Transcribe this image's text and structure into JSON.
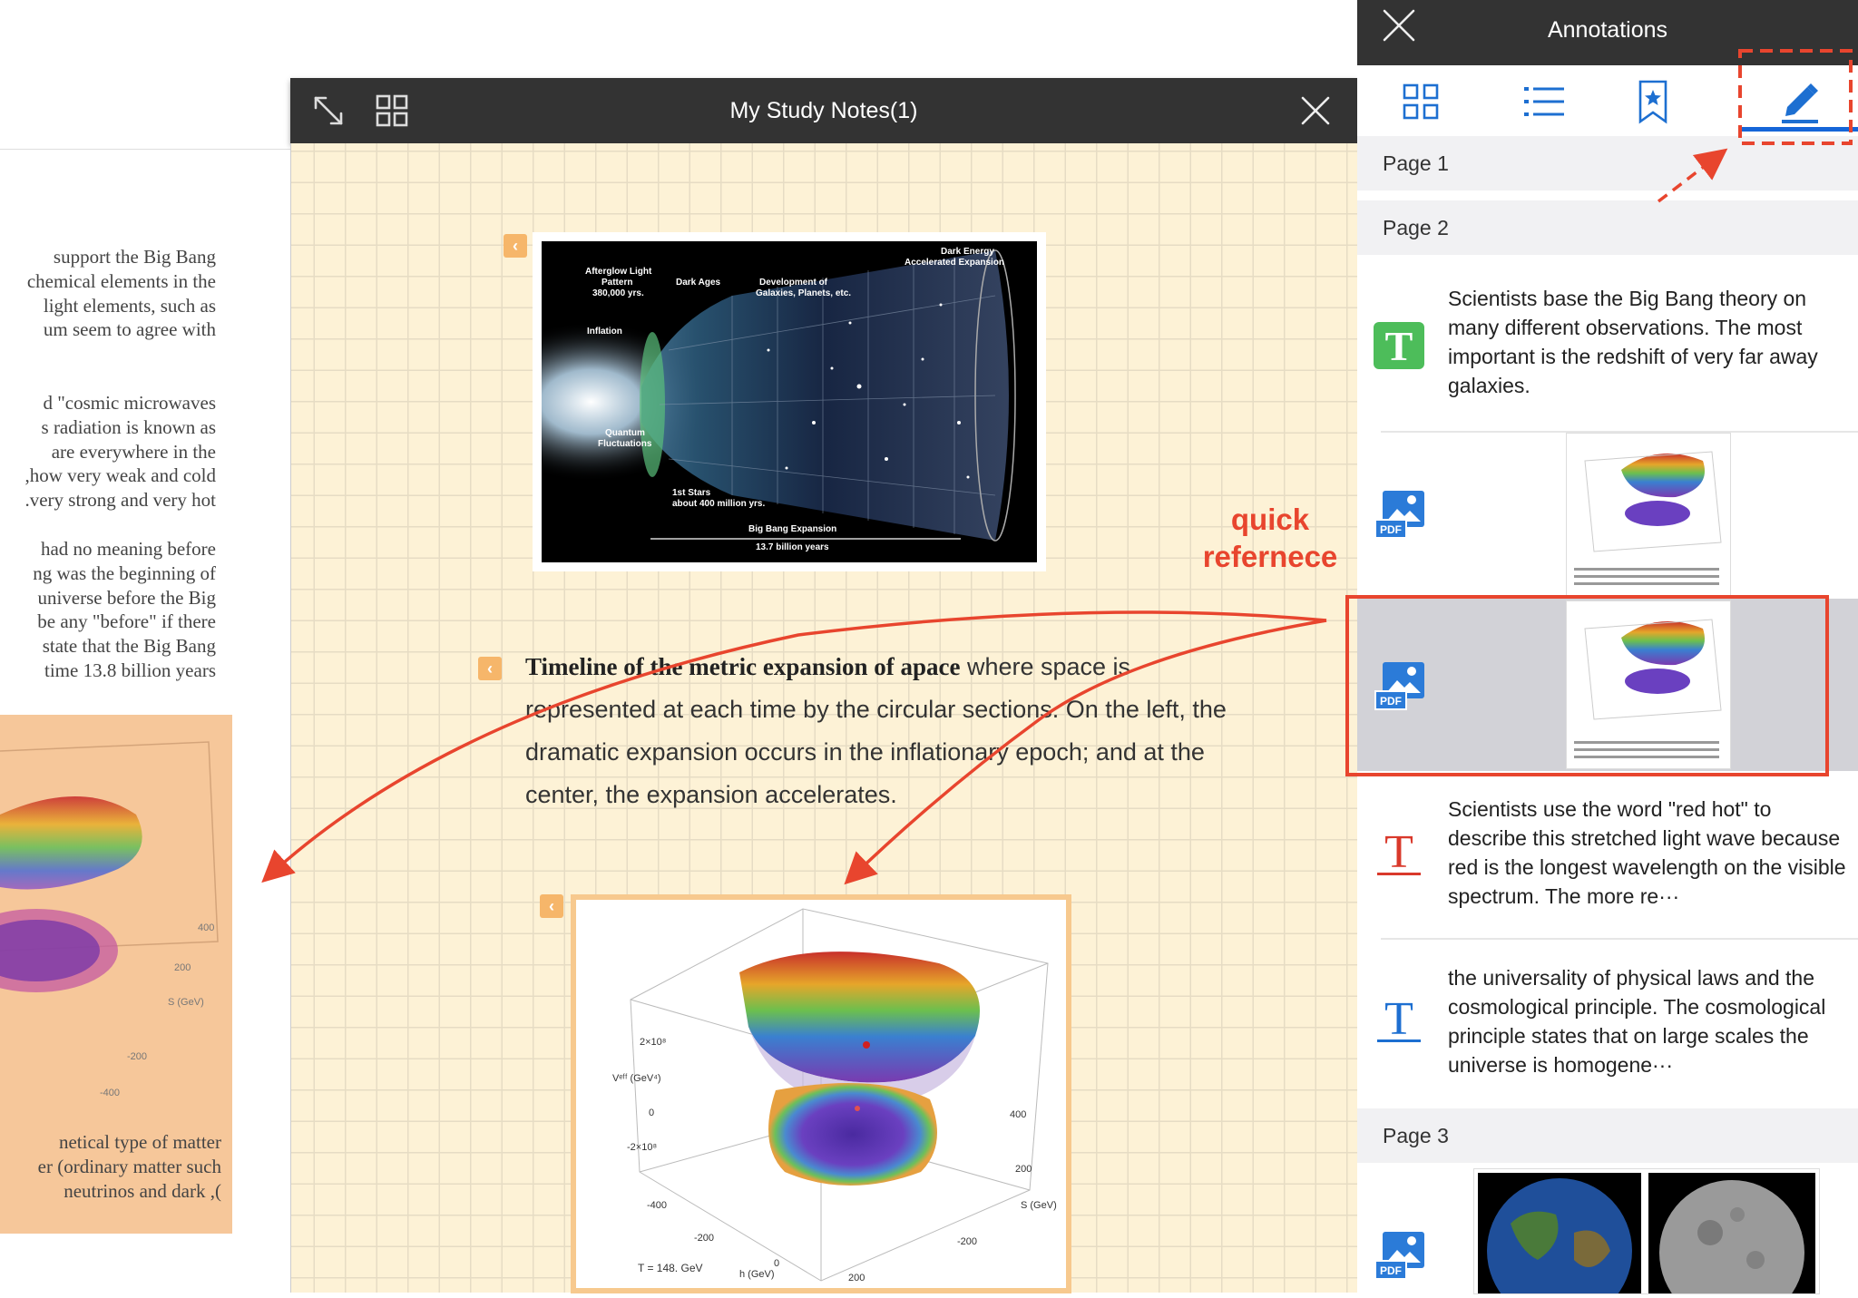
{
  "document": {
    "paragraphs": [
      [
        "support the Big Bang",
        "chemical elements in the",
        "light elements, such as",
        "um seem to agree with"
      ],
      [
        "d \"cosmic microwaves",
        "s radiation is known as",
        "are everywhere in the",
        "how very weak and cold,",
        "very strong and very hot."
      ],
      [
        "had no meaning before",
        "ng was the beginning of",
        "universe before the Big",
        "be any \"before\" if there",
        "state that the Big Bang",
        "time 13.8 billion years"
      ],
      [
        "netical type of matter",
        "er (ordinary matter such",
        "), neutrinos and dark"
      ]
    ]
  },
  "notes_window": {
    "title": "My Study Notes(1)",
    "note": {
      "bold": "Timeline of the metric expansion of apace",
      "text": " where space is represented at each time by the circular sections. On the left, the dramatic expansion occurs in the inflationary epoch; and at the center, the expansion accelerates."
    },
    "universe_image": {
      "labels": {
        "dark_energy": "Dark Energy",
        "accel": "Accelerated Expansion",
        "afterglow": "Afterglow Light",
        "pattern": "Pattern",
        "years380": "380,000 yrs.",
        "dark_ages": "Dark Ages",
        "dev": "Development of",
        "galaxies": "Galaxies, Planets, etc.",
        "inflation": "Inflation",
        "quantum": "Quantum",
        "fluct": "Fluctuations",
        "first_stars": "1st Stars",
        "about400": "about 400 million yrs.",
        "bbe": "Big Bang Expansion",
        "age": "13.7 billion years"
      }
    },
    "plot_image": {
      "t_label": "T = 148.  GeV",
      "axis_v": "Vᵉᶠᶠ (GeV⁴)",
      "axis_h": "h (GeV)",
      "axis_s": "S (GeV)"
    }
  },
  "panel": {
    "title": "Annotations",
    "tabs": [
      "thumbnails",
      "outline",
      "bookmarks",
      "annotations"
    ],
    "sections": {
      "page1": "Page 1",
      "page2": "Page 2",
      "page3": "Page 3"
    },
    "items": [
      {
        "type": "text",
        "text": "Scientists base the Big Bang theory on many different observations. The most important is the redshift of very far away galaxies."
      },
      {
        "type": "image"
      },
      {
        "type": "image"
      },
      {
        "type": "text",
        "text": "Scientists use the word \"red hot\" to describe this stretched light wave because red is the longest wavelength on the visible spectrum. The more re···"
      },
      {
        "type": "text",
        "text": "the universality of physical laws and the cosmological principle. The cosmological principle states that on large scales the universe is homogene···"
      }
    ],
    "pdf_label": "PDF"
  },
  "callout": {
    "label_line1": "quick",
    "label_line2": "refernece"
  },
  "colors": {
    "accent_red": "#e8452e",
    "tab_blue": "#1565d8",
    "icon_green": "#4dbd5a",
    "icon_red": "#d9392b",
    "icon_blue": "#1d6fd1"
  }
}
